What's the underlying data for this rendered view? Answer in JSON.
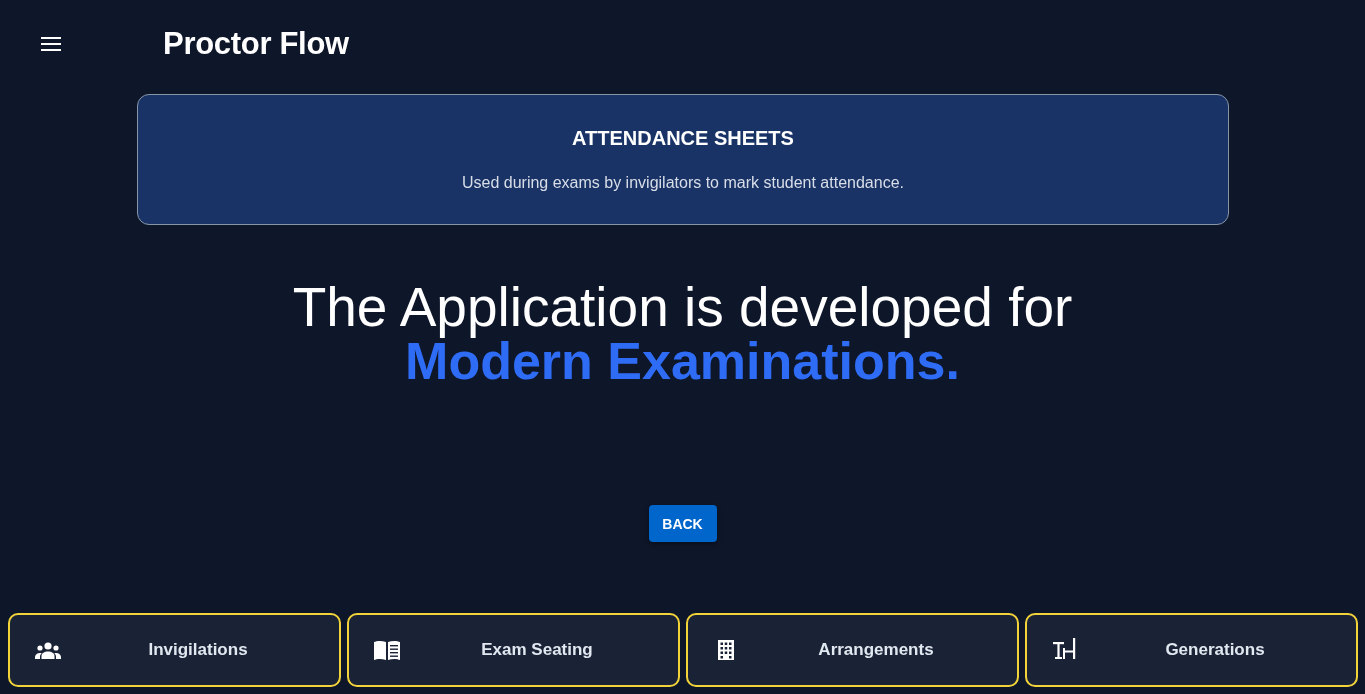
{
  "header": {
    "title": "Proctor Flow"
  },
  "info_card": {
    "title": "ATTENDANCE SHEETS",
    "description": "Used during exams by invigilators to mark student attendance."
  },
  "hero": {
    "line": "The Application is developed for",
    "highlight": "Modern Examinations."
  },
  "back_button": {
    "label": "BACK"
  },
  "bottom_nav": [
    {
      "label": "Invigilations"
    },
    {
      "label": "Exam Seating"
    },
    {
      "label": "Arrangements"
    },
    {
      "label": "Generations"
    }
  ]
}
